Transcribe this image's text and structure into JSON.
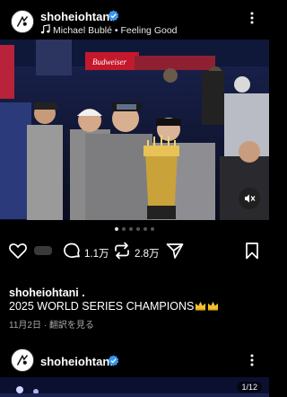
{
  "post": {
    "username": "shoheiohtani",
    "music": "Michael Bublé • Feeling Good",
    "comments_count": "1.1万",
    "reposts_count": "2.8万",
    "caption_user": "shoheiohtani .",
    "caption_text": "2025 WORLD SERIES CHAMPIONS",
    "date": "11月2日",
    "see_translation": "翻訳を見る",
    "photo_banner": "Budweiser",
    "carousel": {
      "count": 6,
      "active": 0
    }
  },
  "next_post": {
    "username": "shoheiohtani",
    "counter": "1/12"
  },
  "colors": {
    "background": "#000000",
    "verified": "#3897f0",
    "muted_text": "#a8a8a8"
  },
  "icons": [
    "avatar-logo-icon",
    "verified-icon",
    "music-note-icon",
    "more-icon",
    "mute-icon",
    "heart-icon",
    "comment-icon",
    "repost-icon",
    "share-icon",
    "bookmark-icon",
    "crown-icon"
  ]
}
